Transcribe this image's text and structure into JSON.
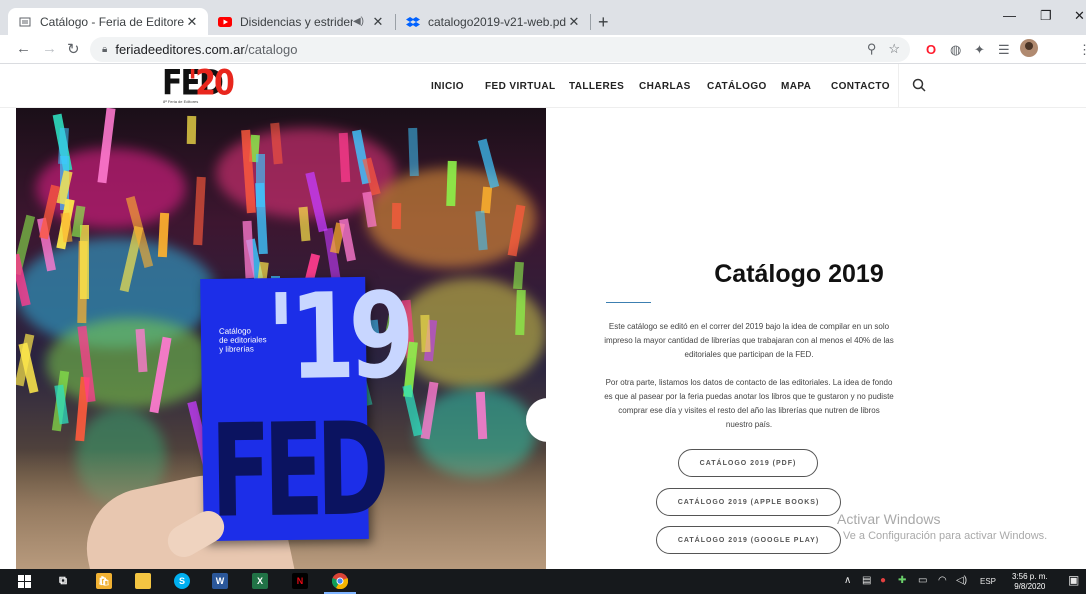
{
  "browser": {
    "tabs": [
      {
        "title": "Catálogo - Feria de Editores",
        "active": true
      },
      {
        "title": "Disidencias y estridencias. La",
        "active": false
      },
      {
        "title": "catalogo2019-v21-web.pdf",
        "active": false
      }
    ],
    "url_domain": "feriadeeditores.com.ar",
    "url_path": "/catalogo"
  },
  "site": {
    "logo_main": "FED",
    "logo_year": "'20",
    "logo_sub": "8ª Feria de Editores",
    "nav": [
      "INICIO",
      "FED VIRTUAL",
      "TALLERES",
      "CHARLAS",
      "CATÁLOGO",
      "MAPA",
      "CONTACTO"
    ]
  },
  "book": {
    "cover_text": "Catálogo\nde editoriales\ny librerías",
    "number": "'19",
    "brand": "FED"
  },
  "main": {
    "title": "Catálogo 2019",
    "paragraph1": "Este catálogo se editó en el correr del 2019 bajo la idea de compilar en un solo impreso la mayor cantidad de librerías que trabajaran con al menos el 40% de las editoriales que participan de la FED.",
    "paragraph2": "Por otra parte, listamos los datos de contacto de las editoriales. La idea de fondo es que al pasear por la feria puedas anotar los libros que te gustaron y no pudiste comprar ese día y visites el resto del año las librerías que nutren de libros nuestro país.",
    "buttons": [
      "CATÁLOGO 2019 (PDF)",
      "CATÁLOGO 2019 (APPLE BOOKS)",
      "CATÁLOGO 2019 (GOOGLE PLAY)"
    ]
  },
  "watermark": {
    "line1": "Activar Windows",
    "line2": "Ve a Configuración para activar Windows."
  },
  "taskbar": {
    "lang": "ESP",
    "time": "3:56 p. m.",
    "date": "9/8/2020"
  },
  "colors": {
    "accent_red": "#e8261d",
    "book_blue": "#1c2ee8",
    "line_blue": "#3c7fb1"
  }
}
